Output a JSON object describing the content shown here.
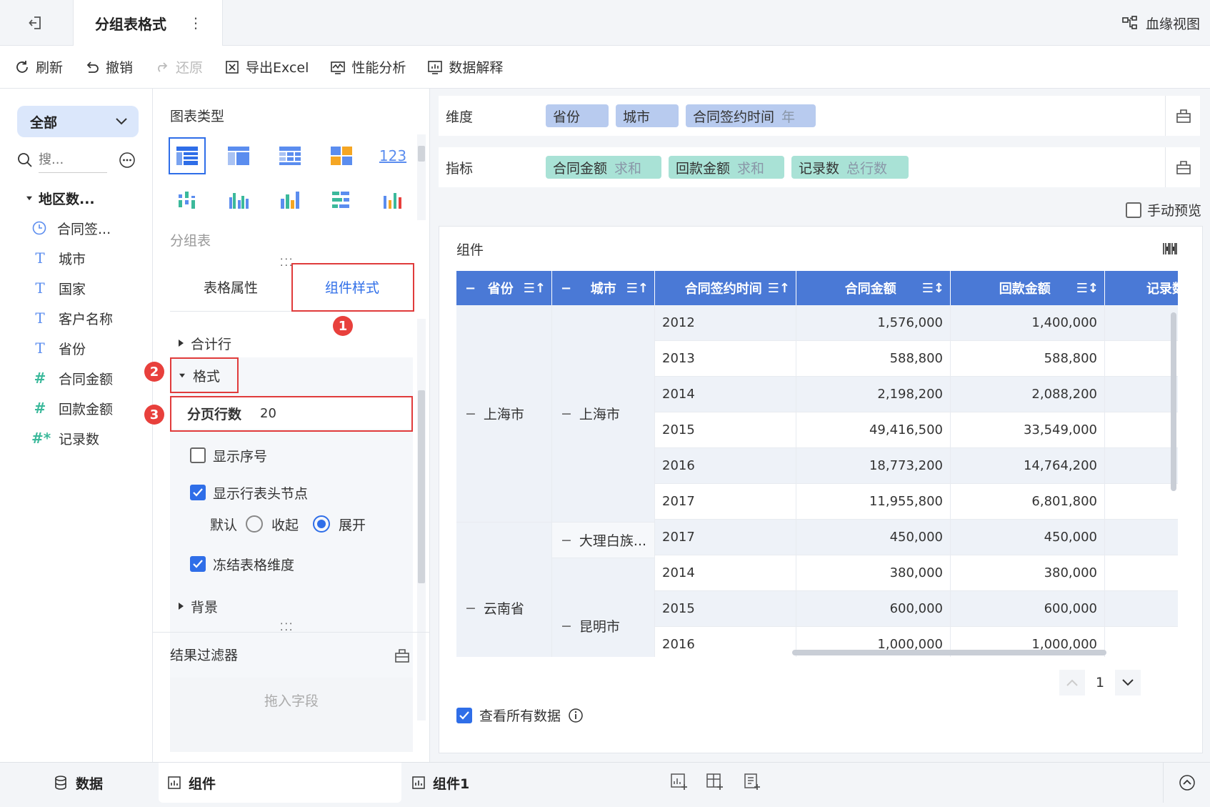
{
  "topbar": {
    "tab_title": "分组表格式",
    "lineage_label": "血缘视图"
  },
  "toolbar": {
    "refresh": "刷新",
    "undo": "撤销",
    "redo": "还原",
    "export": "导出Excel",
    "perf": "性能分析",
    "explain": "数据解释"
  },
  "left": {
    "scope": "全部",
    "search_placeholder": "搜...",
    "dataset": "地区数...",
    "fields": [
      {
        "type": "clock-icon",
        "label": "合同签..."
      },
      {
        "type": "text-icon",
        "label": "城市"
      },
      {
        "type": "text-icon",
        "label": "国家"
      },
      {
        "type": "text-icon",
        "label": "客户名称"
      },
      {
        "type": "text-icon",
        "label": "省份"
      },
      {
        "type": "hash-icon",
        "label": "合同金额"
      },
      {
        "type": "hash-icon",
        "label": "回款金额"
      },
      {
        "type": "hash-star-icon",
        "label": "记录数"
      }
    ]
  },
  "mid": {
    "chart_type_label": "图表类型",
    "chart_type_123": "123",
    "chart_type_name": "分组表",
    "tab_table_props": "表格属性",
    "tab_component_style": "组件样式",
    "section_total_row": "合计行",
    "section_format": "格式",
    "page_rows_label": "分页行数",
    "page_rows_value": "20",
    "show_index": "显示序号",
    "show_header_node": "显示行表头节点",
    "radio_default": "默认",
    "radio_collapse": "收起",
    "radio_expand": "展开",
    "freeze_dims": "冻结表格维度",
    "section_background": "背景",
    "result_filter": "结果过滤器",
    "drop_field": "拖入字段",
    "badges": [
      "1",
      "2",
      "3"
    ]
  },
  "right": {
    "dim_label": "维度",
    "dims": [
      {
        "name": "省份",
        "sub": ""
      },
      {
        "name": "城市",
        "sub": ""
      },
      {
        "name": "合同签约时间",
        "sub": "年"
      }
    ],
    "metric_label": "指标",
    "metrics": [
      {
        "name": "合同金额",
        "sub": "求和"
      },
      {
        "name": "回款金额",
        "sub": "求和"
      },
      {
        "name": "记录数",
        "sub": "总行数"
      }
    ],
    "manual_preview": "手动预览",
    "component_title": "组件",
    "headers": {
      "province": "省份",
      "city": "城市",
      "year": "合同签约时间",
      "amount": "合同金额",
      "payback": "回款金额",
      "count": "记录数"
    },
    "groups": {
      "sh_prov": "上海市",
      "sh_city": "上海市",
      "yn_prov": "云南省",
      "dali": "大理白族...",
      "km": "昆明市"
    },
    "rows": [
      {
        "year": "2012",
        "amount": "1,576,000",
        "payback": "1,400,000"
      },
      {
        "year": "2013",
        "amount": "588,800",
        "payback": "588,800"
      },
      {
        "year": "2014",
        "amount": "2,198,200",
        "payback": "2,088,200"
      },
      {
        "year": "2015",
        "amount": "49,416,500",
        "payback": "33,549,000"
      },
      {
        "year": "2016",
        "amount": "18,773,200",
        "payback": "14,764,200"
      },
      {
        "year": "2017",
        "amount": "11,955,800",
        "payback": "6,801,800"
      },
      {
        "year": "2017",
        "amount": "450,000",
        "payback": "450,000"
      },
      {
        "year": "2014",
        "amount": "380,000",
        "payback": "380,000"
      },
      {
        "year": "2015",
        "amount": "600,000",
        "payback": "600,000"
      },
      {
        "year": "2016",
        "amount": "1,000,000",
        "payback": "1,000,000"
      }
    ],
    "page_number": "1",
    "view_all": "查看所有数据"
  },
  "bottom": {
    "data_tab": "数据",
    "comp_tab": "组件",
    "comp1_tab": "组件1"
  }
}
